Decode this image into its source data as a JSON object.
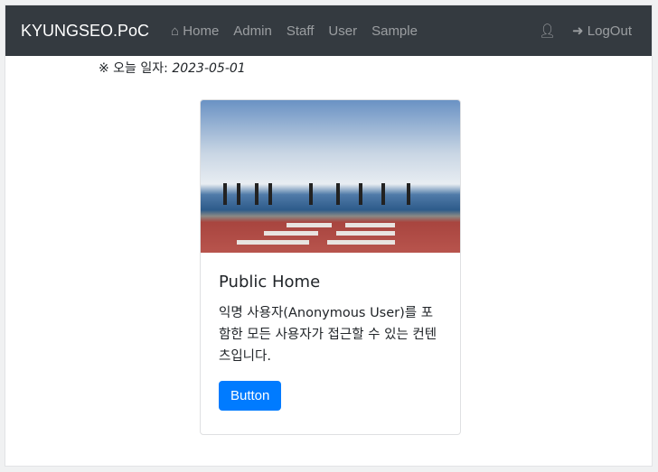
{
  "navbar": {
    "brand": "KYUNGSEO.PoC",
    "links": [
      {
        "label": "Home",
        "icon": "home-icon",
        "active": true
      },
      {
        "label": "Admin"
      },
      {
        "label": "Staff"
      },
      {
        "label": "User"
      },
      {
        "label": "Sample"
      }
    ],
    "user_icon": "user-icon",
    "logout_icon": "sign-out-icon",
    "logout_label": "LogOut"
  },
  "date": {
    "label": "※ 오늘 일자:",
    "value": "2023-05-01"
  },
  "card": {
    "title": "Public Home",
    "text": "익명 사용자(Anonymous User)를 포함한 모든 사용자가 접근할 수 있는 컨텐츠입니다.",
    "button": "Button",
    "accent": "#007bff"
  }
}
